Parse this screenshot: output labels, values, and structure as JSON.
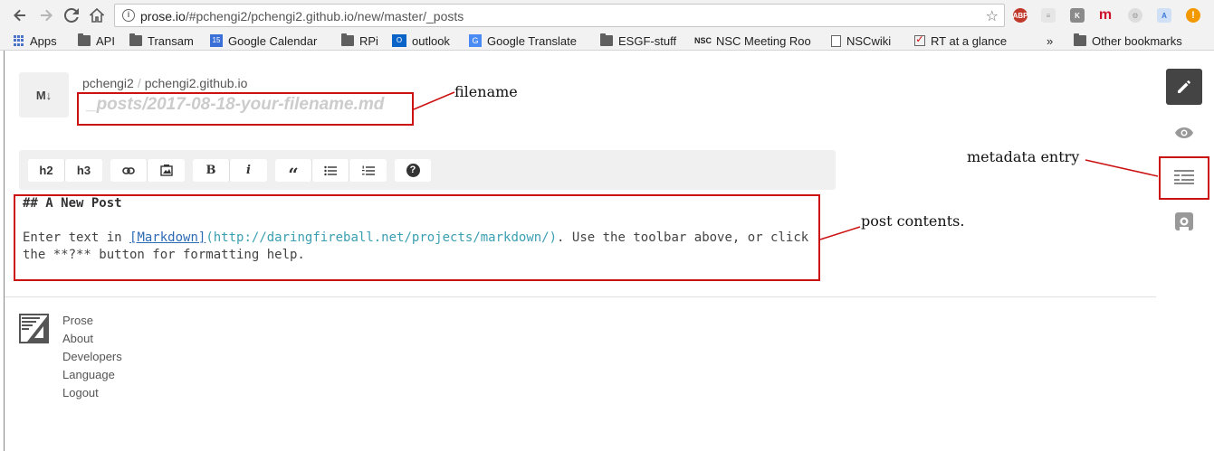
{
  "browser": {
    "url_host": "prose.io",
    "url_path": "/#pchengi2/pchengi2.github.io/new/master/_posts",
    "bookmarks": [
      {
        "label": "Apps",
        "icon": "apps-grid-icon"
      },
      {
        "label": "API",
        "icon": "folder-icon"
      },
      {
        "label": "Transam",
        "icon": "folder-icon"
      },
      {
        "label": "Google Calendar",
        "icon": "calendar-icon"
      },
      {
        "label": "RPi",
        "icon": "folder-icon"
      },
      {
        "label": "outlook",
        "icon": "outlook-icon"
      },
      {
        "label": "Google Translate",
        "icon": "translate-icon"
      },
      {
        "label": "ESGF-stuff",
        "icon": "folder-icon"
      },
      {
        "label": "NSC Meeting Roo",
        "icon": "nsc-icon"
      },
      {
        "label": "NSCwiki",
        "icon": "page-icon"
      },
      {
        "label": "RT at a glance",
        "icon": "rt-icon"
      }
    ],
    "overflow": "»",
    "other_bookmarks": "Other bookmarks"
  },
  "header": {
    "badge": "M↓",
    "user": "pchengi2",
    "separator": "/",
    "repo": "pchengi2.github.io",
    "filename": "_posts/2017-08-18-your-filename.md"
  },
  "toolbar": {
    "h2": "h2",
    "h3": "h3",
    "bold": "B",
    "italic": "i",
    "quote": "“",
    "help": "?"
  },
  "editor": {
    "heading": "## A New Post",
    "text_before": "Enter text in ",
    "link_text": "[Markdown]",
    "link_url": "(http://daringfireball.net/projects/markdown/)",
    "text_after": ". Use the toolbar above, or click",
    "line2": "the **?** button for formatting help."
  },
  "footer": {
    "links": [
      "Prose",
      "About",
      "Developers",
      "Language",
      "Logout"
    ]
  },
  "annotations": {
    "filename": "filename",
    "metadata": "metadata entry",
    "contents": "post contents."
  },
  "colors": {
    "annotation_red": "#cc1111",
    "active_side_button": "#444444",
    "link_blue": "#2e6bb5",
    "url_teal": "#3a9fb1"
  }
}
